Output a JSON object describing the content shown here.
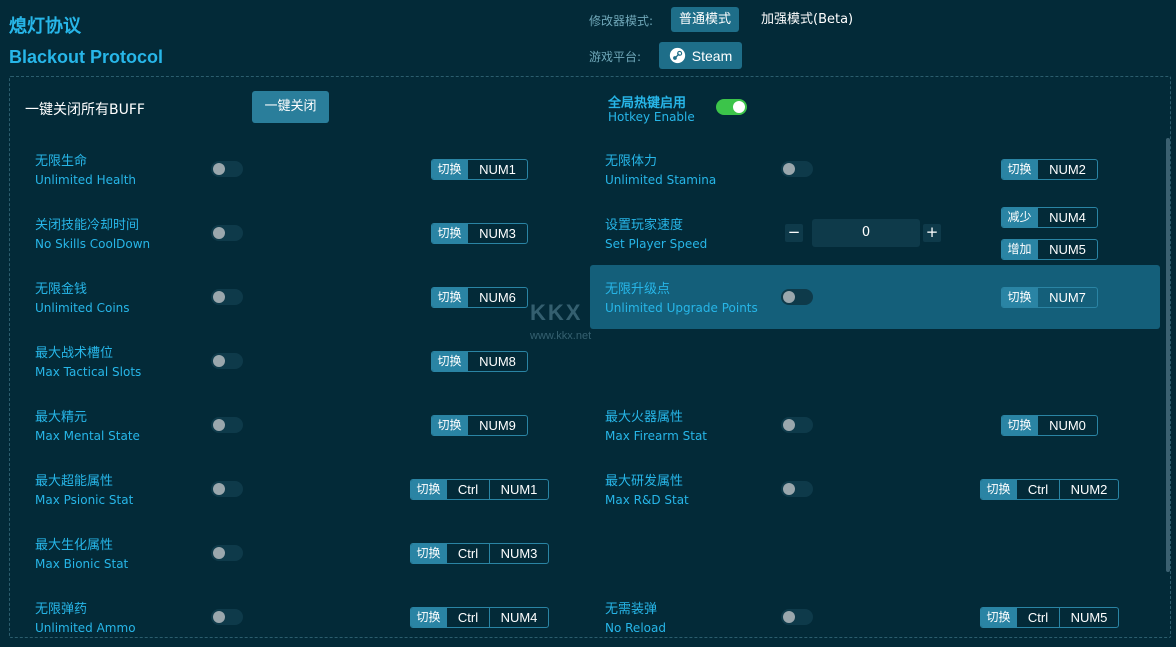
{
  "app": {
    "title_cn": "熄灯协议",
    "title_en": "Blackout Protocol"
  },
  "header": {
    "mode_label": "修改器模式:",
    "mode_normal": "普通模式",
    "mode_beta": "加强模式(Beta)",
    "platform_label": "游戏平台:",
    "platform": "Steam"
  },
  "global": {
    "close_all_label": "一键关闭所有BUFF",
    "close_all_button": "一键关闭",
    "hotkey_cn": "全局热键启用",
    "hotkey_en": "Hotkey Enable",
    "hotkey_enabled": true
  },
  "watermark": {
    "big": "KKX",
    "small": "www.kkx.net"
  },
  "options_left": [
    {
      "cn": "无限生命",
      "en": "Unlimited Health",
      "action": "切换",
      "keys": [
        "NUM1"
      ]
    },
    {
      "cn": "关闭技能冷却时间",
      "en": "No Skills CoolDown",
      "action": "切换",
      "keys": [
        "NUM3"
      ]
    },
    {
      "cn": "无限金钱",
      "en": "Unlimited Coins",
      "action": "切换",
      "keys": [
        "NUM6"
      ]
    },
    {
      "cn": "最大战术槽位",
      "en": "Max Tactical Slots",
      "action": "切换",
      "keys": [
        "NUM8"
      ]
    },
    {
      "cn": "最大精元",
      "en": "Max Mental State",
      "action": "切换",
      "keys": [
        "NUM9"
      ]
    },
    {
      "cn": "最大超能属性",
      "en": "Max Psionic Stat",
      "action": "切换",
      "keys": [
        "Ctrl",
        "NUM1"
      ]
    },
    {
      "cn": "最大生化属性",
      "en": "Max Bionic Stat",
      "action": "切换",
      "keys": [
        "Ctrl",
        "NUM3"
      ]
    },
    {
      "cn": "无限弹药",
      "en": "Unlimited Ammo",
      "action": "切换",
      "keys": [
        "Ctrl",
        "NUM4"
      ]
    }
  ],
  "options_right": [
    {
      "cn": "无限体力",
      "en": "Unlimited Stamina",
      "action": "切换",
      "keys": [
        "NUM2"
      ]
    },
    {
      "cn": "设置玩家速度",
      "en": "Set Player Speed",
      "value": "0",
      "minus": "−",
      "plus": "+",
      "dec_action": "减少",
      "dec_key": "NUM4",
      "inc_action": "增加",
      "inc_key": "NUM5"
    },
    {
      "cn": "无限升级点",
      "en": "Unlimited Upgrade Points",
      "action": "切换",
      "keys": [
        "NUM7"
      ]
    },
    {
      "cn": "最大火器属性",
      "en": "Max Firearm Stat",
      "action": "切换",
      "keys": [
        "NUM0"
      ]
    },
    {
      "cn": "最大研发属性",
      "en": "Max R&D Stat",
      "action": "切换",
      "keys": [
        "Ctrl",
        "NUM2"
      ]
    },
    {
      "cn": "无需装弹",
      "en": "No Reload",
      "action": "切换",
      "keys": [
        "Ctrl",
        "NUM5"
      ]
    }
  ]
}
